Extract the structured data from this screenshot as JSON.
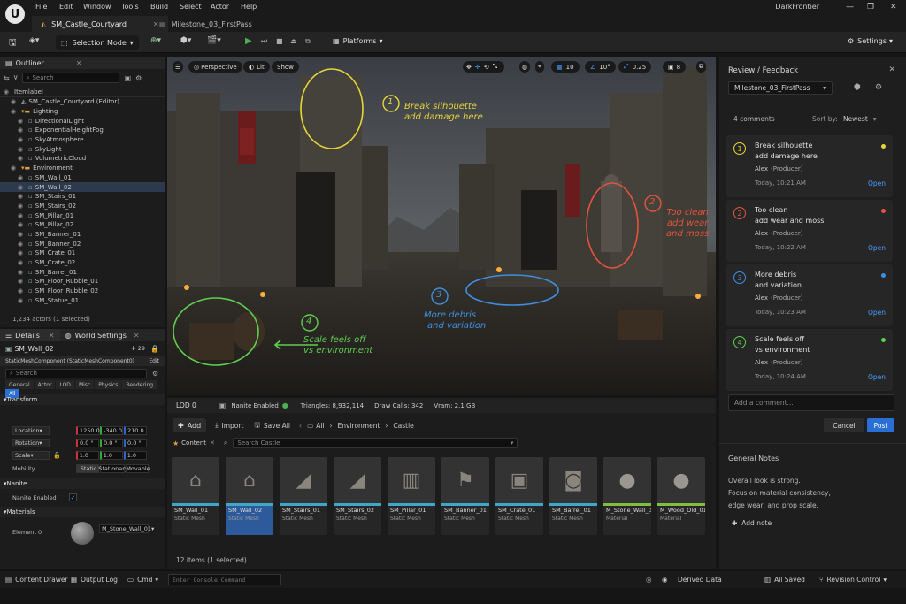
{
  "app": {
    "logo": "U",
    "menu": [
      "File",
      "Edit",
      "Window",
      "Tools",
      "Build",
      "Select",
      "Actor",
      "Help"
    ],
    "tabs": [
      "SM_Castle_Courtyard",
      "Milestone_03_FirstPass"
    ],
    "project": "DarkFrontier"
  },
  "toolbar": {
    "selection_mode": "Selection Mode",
    "platforms": "Platforms",
    "settings": "Settings"
  },
  "outliner": {
    "title": "Outliner",
    "search_placeholder": "Search",
    "column": "Itemlabel",
    "items": [
      {
        "label": "SM_Castle_Courtyard (Editor)",
        "indent": 1,
        "type": "level"
      },
      {
        "label": "Lighting",
        "indent": 1,
        "type": "folder"
      },
      {
        "label": "DirectionalLight",
        "indent": 2,
        "type": "actor"
      },
      {
        "label": "ExponentialHeightFog",
        "indent": 2,
        "type": "actor"
      },
      {
        "label": "SkyAtmosphere",
        "indent": 2,
        "type": "actor"
      },
      {
        "label": "SkyLight",
        "indent": 2,
        "type": "actor"
      },
      {
        "label": "VolumetricCloud",
        "indent": 2,
        "type": "actor"
      },
      {
        "label": "Environment",
        "indent": 1,
        "type": "folder"
      },
      {
        "label": "SM_Wall_01",
        "indent": 2,
        "type": "actor"
      },
      {
        "label": "SM_Wall_02",
        "indent": 2,
        "type": "actor",
        "selected": true
      },
      {
        "label": "SM_Stairs_01",
        "indent": 2,
        "type": "actor"
      },
      {
        "label": "SM_Stairs_02",
        "indent": 2,
        "type": "actor"
      },
      {
        "label": "SM_Pillar_01",
        "indent": 2,
        "type": "actor"
      },
      {
        "label": "SM_Pillar_02",
        "indent": 2,
        "type": "actor"
      },
      {
        "label": "SM_Banner_01",
        "indent": 2,
        "type": "actor"
      },
      {
        "label": "SM_Banner_02",
        "indent": 2,
        "type": "actor"
      },
      {
        "label": "SM_Crate_01",
        "indent": 2,
        "type": "actor"
      },
      {
        "label": "SM_Crate_02",
        "indent": 2,
        "type": "actor"
      },
      {
        "label": "SM_Barrel_01",
        "indent": 2,
        "type": "actor"
      },
      {
        "label": "SM_Floor_Rubble_01",
        "indent": 2,
        "type": "actor"
      },
      {
        "label": "SM_Floor_Rubble_02",
        "indent": 2,
        "type": "actor"
      },
      {
        "label": "SM_Statue_01",
        "indent": 2,
        "type": "actor"
      }
    ],
    "footer": "1,234 actors (1 selected)"
  },
  "details": {
    "tab_details": "Details",
    "tab_world": "World Settings",
    "object": "SM_Wall_02",
    "count": "29",
    "component": "StaticMeshComponent (StaticMeshComponent0)",
    "edit": "Edit",
    "search_placeholder": "Search",
    "categories": [
      "General",
      "Actor",
      "LOD",
      "Misc",
      "Physics",
      "Rendering",
      "All"
    ],
    "transform": "Transform",
    "location": "Location",
    "rotation": "Rotation",
    "scale": "Scale",
    "mobility": "Mobility",
    "loc": [
      "1250.0",
      "-340.0",
      "210.0"
    ],
    "rot": [
      "0.0 °",
      "0.0 °",
      "0.0 °"
    ],
    "scl": [
      "1.0",
      "1.0",
      "1.0"
    ],
    "mob": [
      "Static",
      "Stationary",
      "Movable"
    ],
    "nanite": "Nanite",
    "nanite_enabled": "Nanite Enabled",
    "materials": "Materials",
    "element": "Element 0",
    "material": "M_Stone_Wall_01"
  },
  "viewport": {
    "perspective": "Perspective",
    "lit": "Lit",
    "show": "Show",
    "grid": "10",
    "angle": "10°",
    "scale": "0.25",
    "cam": "8",
    "annotations": [
      {
        "n": "1",
        "text1": "Break silhouette",
        "text2": "add damage here",
        "color": "#e8d637"
      },
      {
        "n": "2",
        "text1": "Too clean",
        "text2": "add wear",
        "text3": "and moss",
        "color": "#e5533d"
      },
      {
        "n": "3",
        "text1": "More debris",
        "text2": "and variation",
        "color": "#3f8fe0"
      },
      {
        "n": "4",
        "text1": "Scale feels off",
        "text2": "vs environment",
        "color": "#5fcf4f"
      }
    ]
  },
  "stats": {
    "lod": "LOD 0",
    "nanite": "Nanite Enabled",
    "triangles": "Triangles: 8,932,114",
    "drawcalls": "Draw Calls: 342",
    "vram": "Vram: 2.1 GB"
  },
  "content": {
    "add": "Add",
    "import": "Import",
    "save_all": "Save All",
    "all": "All",
    "path": [
      "Environment",
      "Castle"
    ],
    "tab": "Content",
    "search_placeholder": "Search Castle",
    "assets": [
      {
        "name": "SM_Wall_01",
        "type": "Static Mesh"
      },
      {
        "name": "SM_Wall_02",
        "type": "Static Mesh",
        "selected": true
      },
      {
        "name": "SM_Stairs_01",
        "type": "Static Mesh"
      },
      {
        "name": "SM_Stairs_02",
        "type": "Static Mesh"
      },
      {
        "name": "SM_Pillar_01",
        "type": "Static Mesh"
      },
      {
        "name": "SM_Banner_01",
        "type": "Static Mesh"
      },
      {
        "name": "SM_Crate_01",
        "type": "Static Mesh"
      },
      {
        "name": "SM_Barrel_01",
        "type": "Static Mesh"
      },
      {
        "name": "M_Stone_Wall_01",
        "type": "Material"
      },
      {
        "name": "M_Wood_Old_01",
        "type": "Material"
      }
    ],
    "footer": "12 items (1 selected)"
  },
  "review": {
    "title": "Review / Feedback",
    "milestone": "Milestone_03_FirstPass",
    "count": "4 comments",
    "sort_label": "Sort by:",
    "sort_value": "Newest",
    "comments": [
      {
        "n": "1",
        "line1": "Break silhouette",
        "line2": "add damage here",
        "author": "Alex",
        "role": "(Producer)",
        "time": "Today, 10:21 AM",
        "status": "Open",
        "color": "#e8d637"
      },
      {
        "n": "2",
        "line1": "Too clean",
        "line2": "add wear and moss",
        "author": "Alex",
        "role": "(Producer)",
        "time": "Today, 10:22 AM",
        "status": "Open",
        "color": "#e5533d"
      },
      {
        "n": "3",
        "line1": "More debris",
        "line2": "and variation",
        "author": "Alex",
        "role": "(Producer)",
        "time": "Today, 10:23 AM",
        "status": "Open",
        "color": "#3f8fe0"
      },
      {
        "n": "4",
        "line1": "Scale feels off",
        "line2": "vs environment",
        "author": "Alex",
        "role": "(Producer)",
        "time": "Today, 10:24 AM",
        "status": "Open",
        "color": "#5fcf4f"
      }
    ],
    "comment_placeholder": "Add a comment...",
    "cancel": "Cancel",
    "post": "Post",
    "general_notes_title": "General Notes",
    "notes": [
      "Overall look is strong.",
      "Focus on material consistency,",
      "edge wear, and prop scale."
    ],
    "add_note": "Add note"
  },
  "status": {
    "content_drawer": "Content Drawer",
    "output_log": "Output Log",
    "cmd": "Cmd",
    "console_placeholder": "Enter Console Command",
    "derived": "Derived Data",
    "saved": "All Saved",
    "revision": "Revision Control"
  }
}
